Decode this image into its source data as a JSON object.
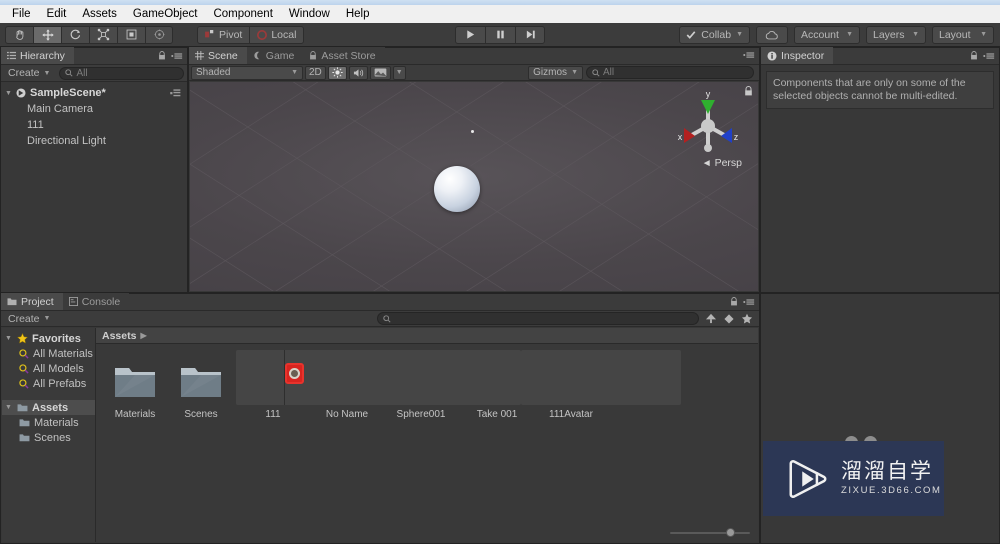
{
  "menubar": {
    "items": [
      "File",
      "Edit",
      "Assets",
      "GameObject",
      "Component",
      "Window",
      "Help"
    ]
  },
  "toolbar": {
    "tools": [
      {
        "name": "hand-tool",
        "icon": "hand",
        "active": false
      },
      {
        "name": "move-tool",
        "icon": "move",
        "active": true
      },
      {
        "name": "rotate-tool",
        "icon": "rotate",
        "active": false
      },
      {
        "name": "scale-tool",
        "icon": "scale",
        "active": false
      },
      {
        "name": "rect-tool",
        "icon": "rect",
        "active": false
      },
      {
        "name": "transform-tool",
        "icon": "transform",
        "active": false
      }
    ],
    "pivot_label": "Pivot",
    "local_label": "Local",
    "play_label": "play-icon",
    "pause_label": "pause-icon",
    "step_label": "step-icon",
    "collab_label": "Collab",
    "cloud_label": "cloud-icon",
    "account_label": "Account",
    "layers_label": "Layers",
    "layout_label": "Layout"
  },
  "hierarchy": {
    "tab_label": "Hierarchy",
    "create_label": "Create",
    "search_placeholder": "All",
    "rows": [
      {
        "label": "SampleScene*",
        "type": "scene",
        "depth": 0,
        "selected": false
      },
      {
        "label": "Main Camera",
        "type": "object",
        "depth": 1,
        "selected": false
      },
      {
        "label": "111",
        "type": "object",
        "depth": 1,
        "selected": true
      },
      {
        "label": "Directional Light",
        "type": "object",
        "depth": 1,
        "selected": false
      }
    ]
  },
  "scene": {
    "tabs": [
      {
        "label": "Scene",
        "active": true
      },
      {
        "label": "Game",
        "active": false
      },
      {
        "label": "Asset Store",
        "active": false
      }
    ],
    "shading_mode": "Shaded",
    "two_d_label": "2D",
    "lighting_icon": "sun-icon",
    "audio_icon": "audio-icon",
    "fx_icon": "effects-icon",
    "gizmos_label": "Gizmos",
    "gizmo_search_placeholder": "All",
    "axis_x": "x",
    "axis_y": "y",
    "axis_z": "z",
    "projection_label": "Persp"
  },
  "inspector": {
    "tab_label": "Inspector",
    "message": "Components that are only on some of the selected objects cannot be multi-edited."
  },
  "project": {
    "tabs": [
      {
        "label": "Project",
        "active": true
      },
      {
        "label": "Console",
        "active": false
      }
    ],
    "create_label": "Create",
    "search_placeholder": "",
    "tree": [
      {
        "label": "Favorites",
        "icon": "star-icon",
        "depth": 0,
        "bold": true
      },
      {
        "label": "All Materials",
        "icon": "search-icon",
        "depth": 1,
        "bold": false
      },
      {
        "label": "All Models",
        "icon": "search-icon",
        "depth": 1,
        "bold": false
      },
      {
        "label": "All Prefabs",
        "icon": "search-icon",
        "depth": 1,
        "bold": false
      },
      {
        "label": "Assets",
        "icon": "folder-icon",
        "depth": 0,
        "bold": true,
        "selected": true
      },
      {
        "label": "Materials",
        "icon": "folder-icon",
        "depth": 1,
        "bold": false
      },
      {
        "label": "Scenes",
        "icon": "folder-icon",
        "depth": 1,
        "bold": false
      }
    ],
    "breadcrumb": "Assets",
    "assets": [
      {
        "label": "Materials",
        "icon": "folder"
      },
      {
        "label": "Scenes",
        "icon": "folder"
      },
      {
        "label": "111",
        "icon": "sphere-small",
        "selected": true
      },
      {
        "label": "No Name",
        "icon": "sphere-large"
      },
      {
        "label": "Sphere001",
        "icon": "sphere-tiny"
      },
      {
        "label": "Take 001",
        "icon": "animation"
      },
      {
        "label": "111Avatar",
        "icon": "avatar"
      }
    ],
    "zoom_value": 70
  },
  "watermark": {
    "title_cn": "溜溜自学",
    "url": "ZIXUE.3D66.COM"
  },
  "colors": {
    "accent_blue": "#4a7fbf",
    "panel_bg": "#383838",
    "toolbar_bg": "#3c3c3c",
    "axis_x": "#b32020",
    "axis_y": "#2fb02f",
    "axis_z": "#2040c8",
    "cursor_red": "#d9241f",
    "watermark_bg": "#2c3755"
  }
}
